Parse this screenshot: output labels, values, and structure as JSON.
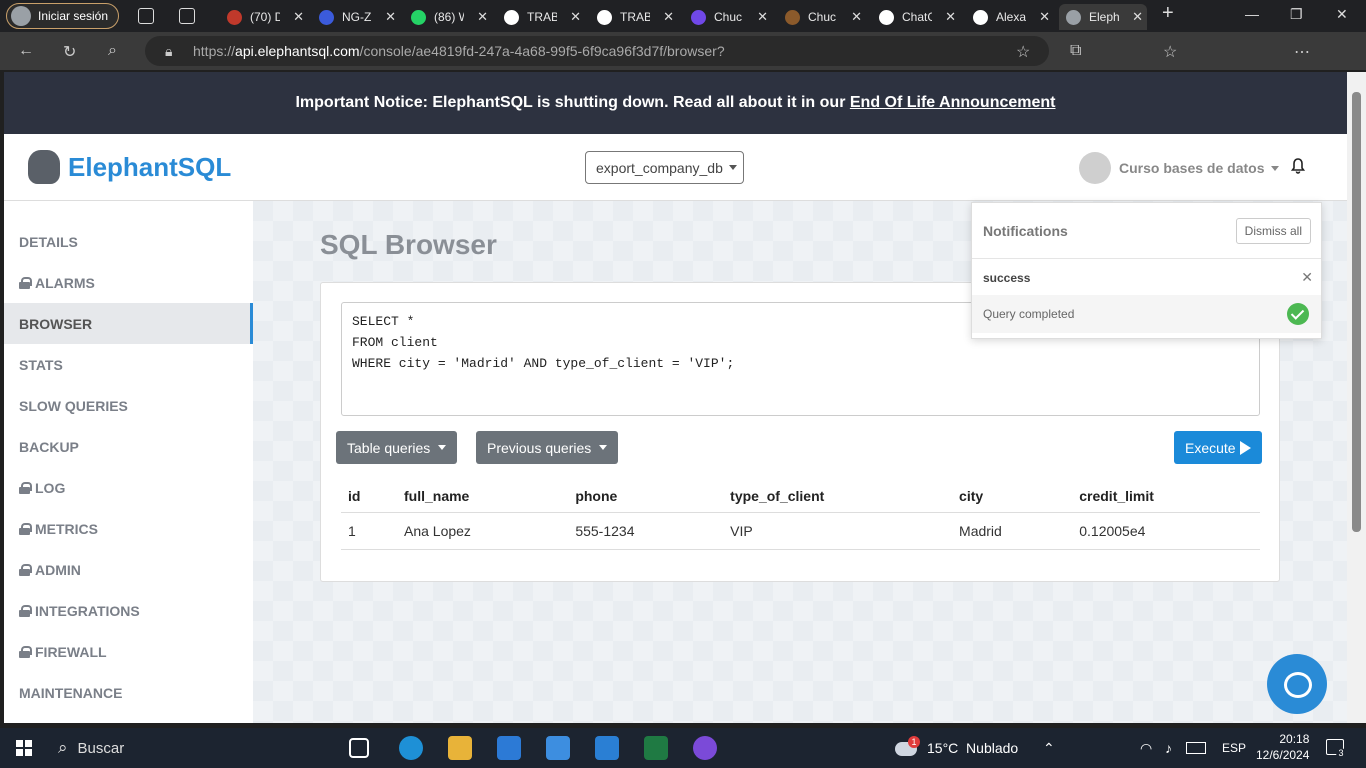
{
  "browser": {
    "profile_label": "Iniciar sesión",
    "tabs": [
      {
        "title": "(70) D",
        "color": "#c0392b"
      },
      {
        "title": "NG-Z",
        "color": "#3b5bdb"
      },
      {
        "title": "(86) W",
        "color": "#25d366"
      },
      {
        "title": "TRAB",
        "color": "#ffffff"
      },
      {
        "title": "TRAB",
        "color": "#ffffff"
      },
      {
        "title": "Chuc",
        "color": "#7048e8"
      },
      {
        "title": "Chuc",
        "color": "#8b5a2b"
      },
      {
        "title": "ChatG",
        "color": "#ffffff"
      },
      {
        "title": "Alexa",
        "color": "#ffffff"
      },
      {
        "title": "Eleph",
        "color": "#9aa0a6"
      }
    ],
    "url_prefix": "https://",
    "url_host": "api.elephantsql.com",
    "url_path": "/console/ae4819fd-247a-4a68-99f5-6f9ca96f3d7f/browser?"
  },
  "notice": {
    "text": "Important Notice: ElephantSQL is shutting down. Read all about it in our ",
    "link": "End Of Life Announcement"
  },
  "header": {
    "brand": "ElephantSQL",
    "db_select": "export_company_db",
    "user": "Curso bases de datos"
  },
  "sidebar": {
    "items": [
      {
        "label": "DETAILS",
        "locked": false
      },
      {
        "label": "ALARMS",
        "locked": true
      },
      {
        "label": "BROWSER",
        "locked": false,
        "active": true
      },
      {
        "label": "STATS",
        "locked": false
      },
      {
        "label": "SLOW QUERIES",
        "locked": false
      },
      {
        "label": "BACKUP",
        "locked": false
      },
      {
        "label": "LOG",
        "locked": true
      },
      {
        "label": "METRICS",
        "locked": true
      },
      {
        "label": "ADMIN",
        "locked": true
      },
      {
        "label": "INTEGRATIONS",
        "locked": true
      },
      {
        "label": "FIREWALL",
        "locked": true
      },
      {
        "label": "MAINTENANCE",
        "locked": false
      }
    ]
  },
  "main": {
    "title": "SQL Browser",
    "query": "SELECT *\nFROM client\nWHERE city = 'Madrid' AND type_of_client = 'VIP';",
    "table_queries_label": "Table queries",
    "previous_queries_label": "Previous queries",
    "execute_label": "Execute",
    "columns": [
      "id",
      "full_name",
      "phone",
      "type_of_client",
      "city",
      "credit_limit"
    ],
    "rows": [
      [
        "1",
        "Ana Lopez",
        "555-1234",
        "VIP",
        "Madrid",
        "0.12005e4"
      ]
    ]
  },
  "notifications": {
    "title": "Notifications",
    "dismiss_label": "Dismiss all",
    "subtitle": "success",
    "message": "Query completed"
  },
  "taskbar": {
    "search_label": "Buscar",
    "weather": "15°C  Nublado",
    "weather_badge": "1",
    "lang": "ESP",
    "time": "20:18",
    "date": "12/6/2024",
    "notif_count": "3"
  }
}
